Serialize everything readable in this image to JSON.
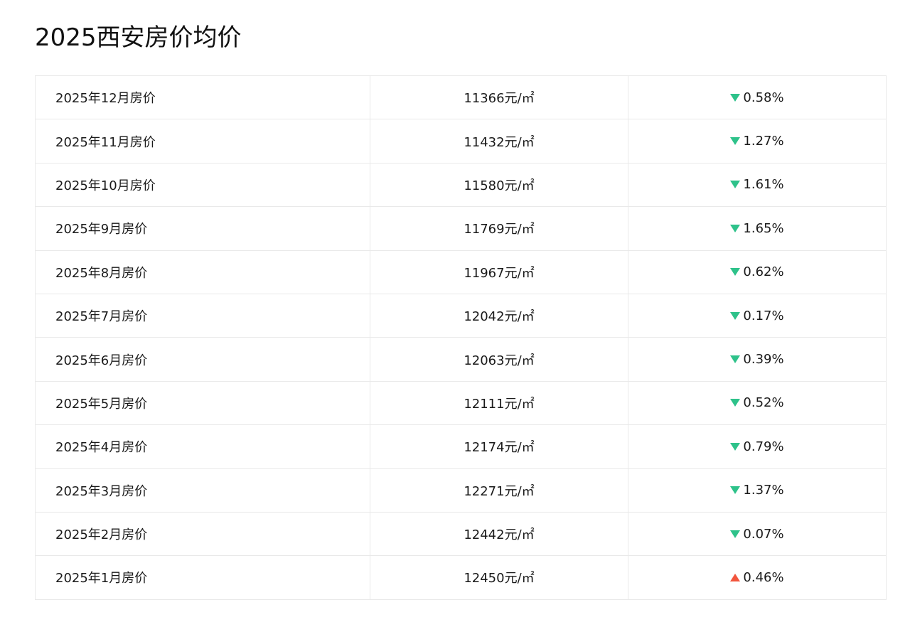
{
  "title": "2025西安房价均价",
  "colors": {
    "down": "#2ec28a",
    "up": "#f2553d",
    "border": "#e9e9e9"
  },
  "rows": [
    {
      "month": "2025年12月房价",
      "price": "11366元/㎡",
      "direction": "down",
      "change": "0.58%"
    },
    {
      "month": "2025年11月房价",
      "price": "11432元/㎡",
      "direction": "down",
      "change": "1.27%"
    },
    {
      "month": "2025年10月房价",
      "price": "11580元/㎡",
      "direction": "down",
      "change": "1.61%"
    },
    {
      "month": "2025年9月房价",
      "price": "11769元/㎡",
      "direction": "down",
      "change": "1.65%"
    },
    {
      "month": "2025年8月房价",
      "price": "11967元/㎡",
      "direction": "down",
      "change": "0.62%"
    },
    {
      "month": "2025年7月房价",
      "price": "12042元/㎡",
      "direction": "down",
      "change": "0.17%"
    },
    {
      "month": "2025年6月房价",
      "price": "12063元/㎡",
      "direction": "down",
      "change": "0.39%"
    },
    {
      "month": "2025年5月房价",
      "price": "12111元/㎡",
      "direction": "down",
      "change": "0.52%"
    },
    {
      "month": "2025年4月房价",
      "price": "12174元/㎡",
      "direction": "down",
      "change": "0.79%"
    },
    {
      "month": "2025年3月房价",
      "price": "12271元/㎡",
      "direction": "down",
      "change": "1.37%"
    },
    {
      "month": "2025年2月房价",
      "price": "12442元/㎡",
      "direction": "down",
      "change": "0.07%"
    },
    {
      "month": "2025年1月房价",
      "price": "12450元/㎡",
      "direction": "up",
      "change": "0.46%"
    }
  ]
}
